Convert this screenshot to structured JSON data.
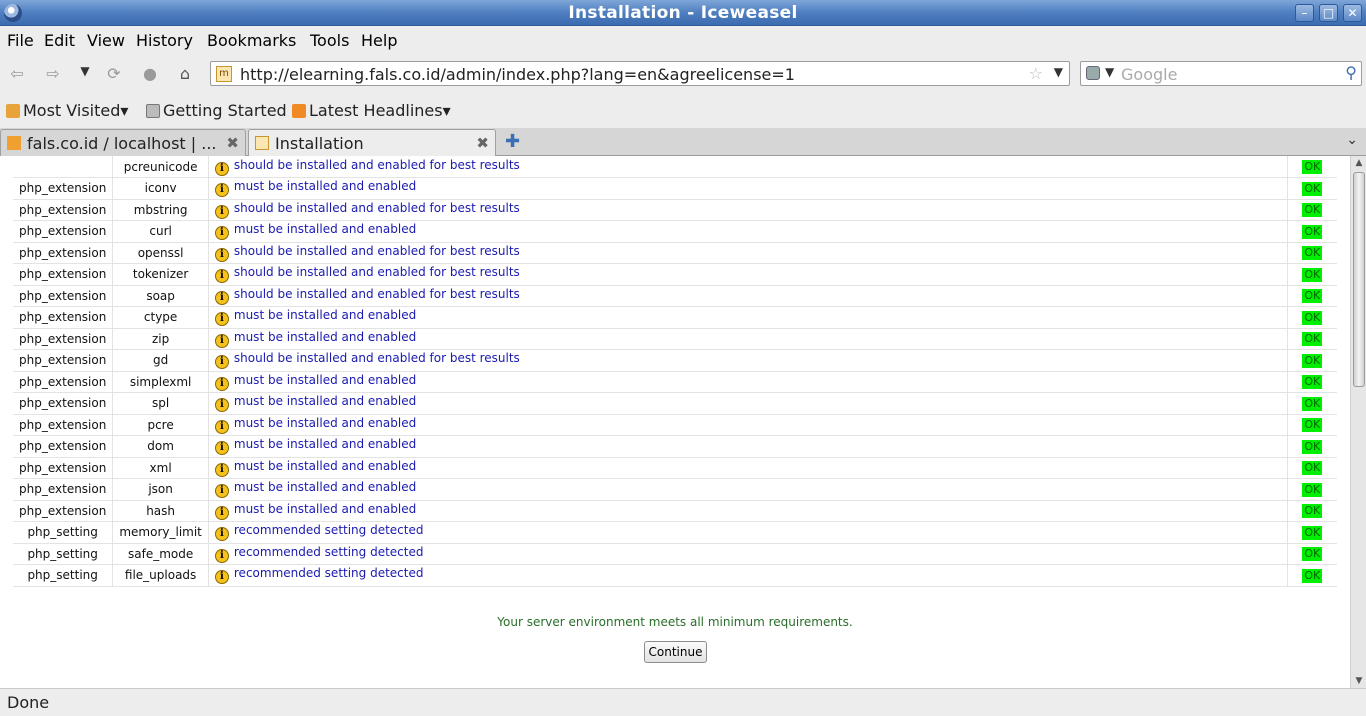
{
  "window": {
    "title": "Installation - Iceweasel"
  },
  "menu": [
    "File",
    "Edit",
    "View",
    "History",
    "Bookmarks",
    "Tools",
    "Help"
  ],
  "navbar": {
    "url": "http://elearning.fals.co.id/admin/index.php?lang=en&agreelicense=1",
    "search_placeholder": "Google"
  },
  "bookmarks": [
    "Most Visited",
    "Getting Started",
    "Latest Headlines"
  ],
  "tabs": [
    {
      "label": "fals.co.id / localhost | ...",
      "active": false
    },
    {
      "label": "Installation",
      "active": true
    }
  ],
  "requirements": [
    {
      "type": "",
      "name": "pcreunicode",
      "message": "should be installed and enabled for best results",
      "status": "OK"
    },
    {
      "type": "php_extension",
      "name": "iconv",
      "message": "must be installed and enabled",
      "status": "OK"
    },
    {
      "type": "php_extension",
      "name": "mbstring",
      "message": "should be installed and enabled for best results",
      "status": "OK"
    },
    {
      "type": "php_extension",
      "name": "curl",
      "message": "must be installed and enabled",
      "status": "OK"
    },
    {
      "type": "php_extension",
      "name": "openssl",
      "message": "should be installed and enabled for best results",
      "status": "OK"
    },
    {
      "type": "php_extension",
      "name": "tokenizer",
      "message": "should be installed and enabled for best results",
      "status": "OK"
    },
    {
      "type": "php_extension",
      "name": "soap",
      "message": "should be installed and enabled for best results",
      "status": "OK"
    },
    {
      "type": "php_extension",
      "name": "ctype",
      "message": "must be installed and enabled",
      "status": "OK"
    },
    {
      "type": "php_extension",
      "name": "zip",
      "message": "must be installed and enabled",
      "status": "OK"
    },
    {
      "type": "php_extension",
      "name": "gd",
      "message": "should be installed and enabled for best results",
      "status": "OK"
    },
    {
      "type": "php_extension",
      "name": "simplexml",
      "message": "must be installed and enabled",
      "status": "OK"
    },
    {
      "type": "php_extension",
      "name": "spl",
      "message": "must be installed and enabled",
      "status": "OK"
    },
    {
      "type": "php_extension",
      "name": "pcre",
      "message": "must be installed and enabled",
      "status": "OK"
    },
    {
      "type": "php_extension",
      "name": "dom",
      "message": "must be installed and enabled",
      "status": "OK"
    },
    {
      "type": "php_extension",
      "name": "xml",
      "message": "must be installed and enabled",
      "status": "OK"
    },
    {
      "type": "php_extension",
      "name": "json",
      "message": "must be installed and enabled",
      "status": "OK"
    },
    {
      "type": "php_extension",
      "name": "hash",
      "message": "must be installed and enabled",
      "status": "OK"
    },
    {
      "type": "php_setting",
      "name": "memory_limit",
      "message": "recommended setting detected",
      "status": "OK"
    },
    {
      "type": "php_setting",
      "name": "safe_mode",
      "message": "recommended setting detected",
      "status": "OK"
    },
    {
      "type": "php_setting",
      "name": "file_uploads",
      "message": "recommended setting detected",
      "status": "OK"
    }
  ],
  "summary": "Your server environment meets all minimum requirements.",
  "continue_label": "Continue",
  "status_text": "Done",
  "colors": {
    "ok_bg": "#00ee00",
    "link_blue": "#1a1ab0",
    "summary_green": "#2a6e2a"
  }
}
